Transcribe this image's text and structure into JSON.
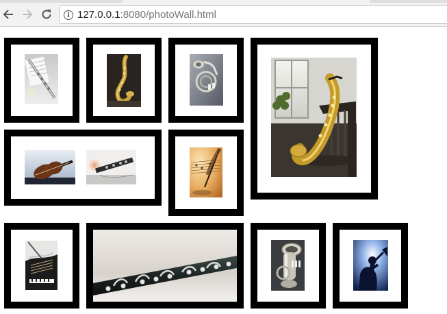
{
  "browser": {
    "url_host": "127.0.0.1",
    "url_rest": ":8080/photoWall.html",
    "url_full": "127.0.0.1:8080/photoWall.html"
  },
  "colors": {
    "frame": "#000000",
    "page_background": "#ffffff",
    "toolbar": "#f2f2f2"
  },
  "icons": {
    "back": "arrow-left-icon",
    "forward": "arrow-right-icon",
    "reload": "reload-icon",
    "site_info": "info-circle-icon"
  },
  "photo_wall": [
    {
      "id": "frame-1",
      "photos": [
        "flute-on-sheet-music"
      ]
    },
    {
      "id": "frame-2",
      "photos": [
        "saxophone-dark"
      ]
    },
    {
      "id": "frame-3",
      "photos": [
        "french-horn"
      ]
    },
    {
      "id": "frame-4",
      "photos": [
        "saxophone-on-chair"
      ]
    },
    {
      "id": "frame-5",
      "photos": [
        "violin",
        "clarinet-with-rose"
      ]
    },
    {
      "id": "frame-6",
      "photos": [
        "sheet-music-with-quill"
      ]
    },
    {
      "id": "frame-7",
      "photos": [
        "grand-piano"
      ]
    },
    {
      "id": "frame-8",
      "photos": [
        "clarinet-closeup"
      ]
    },
    {
      "id": "frame-9",
      "photos": [
        "tuba"
      ]
    },
    {
      "id": "frame-10",
      "photos": [
        "trumpet-player-silhouette"
      ]
    }
  ]
}
